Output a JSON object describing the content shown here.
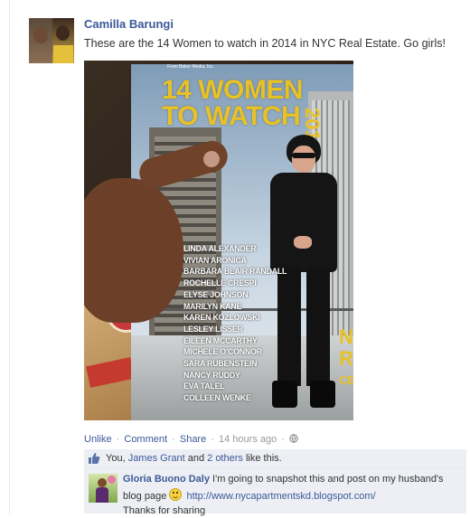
{
  "post": {
    "author": "Camilla Barungi",
    "text": "These are the 14 Women to watch in 2014 in NYC Real Estate. Go girls!",
    "photo": {
      "magazine_header": "From Baker Media, Inc.",
      "magazine_title_line1": "14 WOMEN",
      "magazine_title_line2": "TO WATCH",
      "magazine_year": "2014",
      "side_letters": [
        "N",
        "R",
        "CE"
      ],
      "names": [
        "LINDA ALEXANDER",
        "VIVIAN ARONICA",
        "BARBARA BLAIR RANDALL",
        "ROCHELLE CRESPI",
        "ELYSE JOHNSON",
        "MARILYN KANE",
        "KAREN KOZLOWSKI",
        "LESLEY LISSER",
        "EILEEN MCCARTHY",
        "MICHELE O'CONNOR",
        "SARA RUBENSTEIN",
        "NANCY RUDDY",
        "EVA TALEL",
        "COLLEEN WENKE"
      ]
    },
    "actions": {
      "unlike": "Unlike",
      "comment": "Comment",
      "share": "Share",
      "separator": "·",
      "timestamp": "14 hours ago"
    },
    "likes": {
      "prefix": "You,",
      "name": "James Grant",
      "middle": "and",
      "others": "2 others",
      "suffix": "like this."
    },
    "comment": {
      "author": "Gloria Buono Daly",
      "text_part1": "I'm going to snapshot this and post on my husband's blog page",
      "emoticon": "smiley-icon",
      "url": "http://www.nycapartmentskd.blogspot.com/",
      "text_part2": "Thanks for sharing"
    }
  },
  "colors": {
    "link": "#3b5998",
    "muted": "#999999",
    "comment_bg": "#edeff4",
    "magazine_title": "#e8c225"
  }
}
